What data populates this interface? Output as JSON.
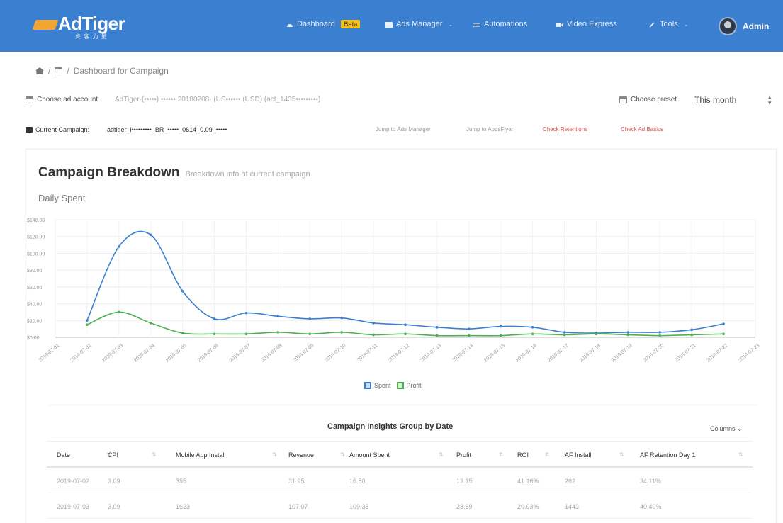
{
  "nav": {
    "logo_text": "AdTiger",
    "logo_sub": "虎 客 力 量",
    "items": [
      {
        "label": "Dashboard",
        "badge": "Beta"
      },
      {
        "label": "Ads Manager"
      },
      {
        "label": "Automations"
      },
      {
        "label": "Video Express"
      },
      {
        "label": "Tools"
      }
    ],
    "user": "Admin"
  },
  "breadcrumb": {
    "page": "Dashboard for Campaign",
    "sep": "/"
  },
  "account": {
    "label": "Choose ad account",
    "value": "AdTiger-(•••••) •••••• 20180208- (US•••••• (USD) (act_1435•••••••••)",
    "preset_label": "Choose preset",
    "preset_value": "This month"
  },
  "campaign": {
    "label": "Current Campaign:",
    "name": "adtiger_i•••••••••_BR_•••••_0614_0.09_•••••",
    "links": [
      "Jump to Ads Manager",
      "Jump to AppsFlyer"
    ],
    "red_links": [
      "Check Retentions",
      "Check Ad Basics"
    ]
  },
  "panel": {
    "title": "Campaign Breakdown",
    "subtitle": "Breakdown info of current campaign",
    "section": "Daily Spent"
  },
  "chart_data": {
    "type": "line",
    "x": [
      "2019-07-01",
      "2019-07-02",
      "2019-07-03",
      "2019-07-04",
      "2019-07-05",
      "2019-07-06",
      "2019-07-07",
      "2019-07-08",
      "2019-07-09",
      "2019-07-10",
      "2019-07-11",
      "2019-07-12",
      "2019-07-13",
      "2019-07-14",
      "2019-07-15",
      "2019-07-16",
      "2019-07-17",
      "2019-07-18",
      "2019-07-19",
      "2019-07-20",
      "2019-07-21",
      "2019-07-22",
      "2019-07-23"
    ],
    "series": [
      {
        "name": "Spent",
        "color": "#3b7fd1",
        "values": [
          20,
          108,
          122,
          55,
          22,
          29,
          25,
          22,
          23,
          17,
          15,
          12,
          10,
          13,
          12,
          6,
          5,
          6,
          6,
          9,
          16
        ]
      },
      {
        "name": "Profit",
        "color": "#4caf50",
        "values": [
          15,
          30,
          17,
          5,
          4,
          4,
          6,
          4,
          6,
          3,
          4,
          2,
          2,
          2,
          4,
          3,
          4,
          3,
          2,
          3,
          4
        ]
      }
    ],
    "ylim": [
      0,
      140
    ],
    "y_ticks": [
      "$0.00",
      "$20.00",
      "$40.00",
      "$60.00",
      "$80.00",
      "$100.00",
      "$120.00",
      "$140.00"
    ],
    "grid": true,
    "legend": "bottom"
  },
  "table": {
    "title": "Campaign Insights Group by Date",
    "columns_btn": "Columns",
    "headers": [
      "Date",
      "CPI",
      "Mobile App Install",
      "Revenue",
      "Amount Spent",
      "Profit",
      "ROI",
      "AF Install",
      "AF Retention Day 1"
    ],
    "rows": [
      [
        "2019-07-02",
        "3.09",
        "355",
        "31.95",
        "16.80",
        "13.15",
        "41.16%",
        "262",
        "34.11%"
      ],
      [
        "2019-07-03",
        "3.09",
        "1623",
        "107.07",
        "109.38",
        "28.69",
        "20.03%",
        "1443",
        "40.40%"
      ]
    ]
  }
}
